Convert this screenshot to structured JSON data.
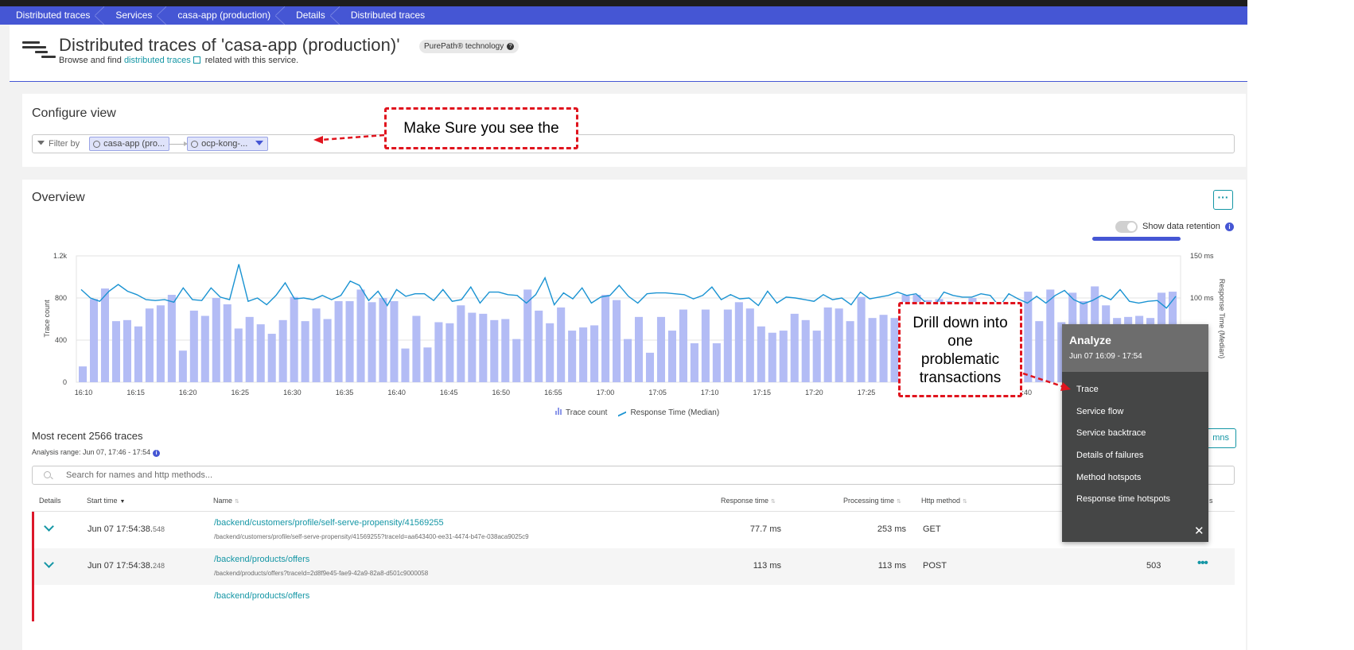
{
  "breadcrumb": [
    "Distributed traces",
    "Services",
    "casa-app (production)",
    "Details",
    "Distributed traces"
  ],
  "header": {
    "title": "Distributed traces of 'casa-app (production)'",
    "badge": "PurePath® technology",
    "subtitle_pre": "Browse and find ",
    "subtitle_link": "distributed traces",
    "subtitle_post": " related with this service."
  },
  "configure": {
    "title": "Configure view",
    "filter_label": "Filter by",
    "chip1": "casa-app (pro...",
    "chip2": "ocp-kong-..."
  },
  "overview": {
    "title": "Overview",
    "more_label": "···",
    "retention_label": "Show data retention"
  },
  "chart_data": {
    "type": "bar",
    "title": "",
    "ylabel": "Trace count",
    "y2label": "Response Time (Median)",
    "ylim": [
      0,
      1200
    ],
    "y2lim": [
      0,
      150
    ],
    "yticks": [
      "0",
      "400",
      "800",
      "1.2k"
    ],
    "y2ticks": [
      "100 ms",
      "150 ms"
    ],
    "xticks": [
      "16:10",
      "16:15",
      "16:20",
      "16:25",
      "16:30",
      "16:35",
      "16:40",
      "16:45",
      "16:50",
      "16:55",
      "17:00",
      "17:05",
      "17:10",
      "17:15",
      "17:20",
      "17:25",
      "17:30",
      "17:35",
      "17:40"
    ],
    "series": [
      {
        "name": "Trace count",
        "type": "bar",
        "values": [
          150,
          790,
          890,
          580,
          590,
          530,
          700,
          730,
          830,
          300,
          680,
          630,
          800,
          740,
          510,
          620,
          550,
          460,
          590,
          810,
          580,
          700,
          600,
          770,
          770,
          880,
          760,
          800,
          770,
          320,
          630,
          330,
          570,
          560,
          730,
          660,
          650,
          590,
          600,
          410,
          880,
          680,
          560,
          710,
          490,
          520,
          540,
          830,
          780,
          410,
          620,
          280,
          620,
          490,
          690,
          370,
          690,
          370,
          690,
          760,
          700,
          530,
          470,
          490,
          650,
          590,
          490,
          710,
          700,
          580,
          810,
          610,
          640,
          610,
          830,
          830,
          780,
          790,
          770,
          620,
          800,
          610,
          620,
          650,
          720,
          860,
          580,
          880,
          570,
          850,
          770,
          910,
          730,
          610,
          620,
          630,
          610,
          850,
          860
        ],
        "x": [
          "16:10",
          "16:10",
          "16:11",
          "16:12",
          "16:13",
          "16:13",
          "16:14",
          "16:15",
          "16:16",
          "16:16",
          "16:17",
          "16:18",
          "16:19",
          "16:19",
          "16:20",
          "16:21",
          "16:22",
          "16:22",
          "16:23",
          "16:24",
          "16:25",
          "16:25",
          "16:26",
          "16:27",
          "16:28",
          "16:28",
          "16:29",
          "16:30",
          "16:31",
          "16:31",
          "16:32",
          "16:33",
          "16:34",
          "16:34",
          "16:35",
          "16:36",
          "16:37",
          "16:37",
          "16:38",
          "16:39",
          "16:40",
          "16:40",
          "16:41",
          "16:42",
          "16:43",
          "16:43",
          "16:44",
          "16:45",
          "16:46",
          "16:46",
          "16:47",
          "16:48",
          "16:49",
          "16:49",
          "16:50",
          "16:51",
          "16:52",
          "16:52",
          "16:53",
          "16:54",
          "16:55",
          "16:55",
          "16:56",
          "16:57",
          "16:58",
          "16:58",
          "16:59",
          "17:00",
          "17:01",
          "17:01",
          "17:02",
          "17:03",
          "17:04",
          "17:04",
          "17:05",
          "17:06",
          "17:07",
          "17:07",
          "17:08",
          "17:09",
          "17:10",
          "17:10",
          "17:11",
          "17:12",
          "17:13",
          "17:13",
          "17:14",
          "17:15",
          "17:16",
          "17:16",
          "17:17",
          "17:18",
          "17:19",
          "17:19",
          "17:20",
          "17:21",
          "17:22",
          "17:22",
          "17:23"
        ]
      },
      {
        "name": "Response Time (Median)",
        "type": "line",
        "axis": "right",
        "values": [
          110,
          100,
          96,
          108,
          116,
          108,
          104,
          98,
          97,
          98,
          95,
          112,
          98,
          97,
          112,
          101,
          98,
          140,
          96,
          100,
          92,
          103,
          118,
          99,
          100,
          98,
          103,
          98,
          103,
          120,
          115,
          97,
          108,
          91,
          110,
          102,
          105,
          105,
          97,
          110,
          96,
          98,
          113,
          94,
          107,
          107,
          104,
          103,
          94,
          104,
          124,
          92,
          106,
          99,
          112,
          94,
          101,
          103,
          115,
          102,
          94,
          105,
          106,
          106,
          105,
          104,
          99,
          103,
          113,
          98,
          104,
          99,
          100,
          91,
          108,
          94,
          101,
          100,
          98,
          96,
          104,
          98,
          100,
          92,
          107,
          99,
          101,
          103,
          107,
          103,
          105,
          95,
          91,
          107,
          103,
          101,
          101,
          105,
          103,
          90,
          105,
          99,
          94,
          102,
          94,
          103,
          109,
          98,
          93,
          97,
          103,
          98,
          110,
          96,
          94,
          96,
          97,
          88,
          102
        ]
      }
    ],
    "legend": [
      "Trace count",
      "Response Time (Median)"
    ],
    "legend_position": "bottom"
  },
  "traces": {
    "heading": "Most recent 2566 traces",
    "range": "Analysis range: Jun 07, 17:46 - 17:54",
    "columns_btn": "mns",
    "search_placeholder": "Search for names and http methods...",
    "columns": {
      "details": "Details",
      "start": "Start time",
      "name": "Name",
      "response": "Response time",
      "processing": "Processing time",
      "method": "Http method",
      "status": "s"
    },
    "rows": [
      {
        "time": "Jun 07 17:54:38.",
        "ms": "548",
        "name": "/backend/customers/profile/self-serve-propensity/41569255",
        "url": "/backend/customers/profile/self-serve-propensity/41569255?traceId=aa643400-ee31-4474-b47e-038aca9025c9",
        "rt": "77.7 ms",
        "pt": "253 ms",
        "method": "GET",
        "code": ""
      },
      {
        "time": "Jun 07 17:54:38.",
        "ms": "248",
        "name": "/backend/products/offers",
        "url": "/backend/products/offers?traceId=2d8f9e45-fae9-42a9-82a8-d501c9000058",
        "rt": "113 ms",
        "pt": "113 ms",
        "method": "POST",
        "code": "503"
      },
      {
        "time": "",
        "ms": "",
        "name": "/backend/products/offers",
        "url": "",
        "rt": "",
        "pt": "",
        "method": "",
        "code": ""
      }
    ]
  },
  "annotations": {
    "callout1": "Make Sure you see the",
    "callout2_lines": [
      "Drill down into",
      "one",
      "problematic",
      "transactions"
    ]
  },
  "analyze_menu": {
    "title": "Analyze",
    "range": "Jun 07 16:09 - 17:54",
    "items": [
      "Trace",
      "Service flow",
      "Service backtrace",
      "Details of failures",
      "Method hotspots",
      "Response time hotspots"
    ],
    "close": "✕"
  },
  "colors": {
    "brand": "#4556d4",
    "bar": "#b3bcf5",
    "line": "#1a93d2",
    "error": "#dc172a",
    "link": "#1496a5",
    "annotation": "#e0141e"
  }
}
